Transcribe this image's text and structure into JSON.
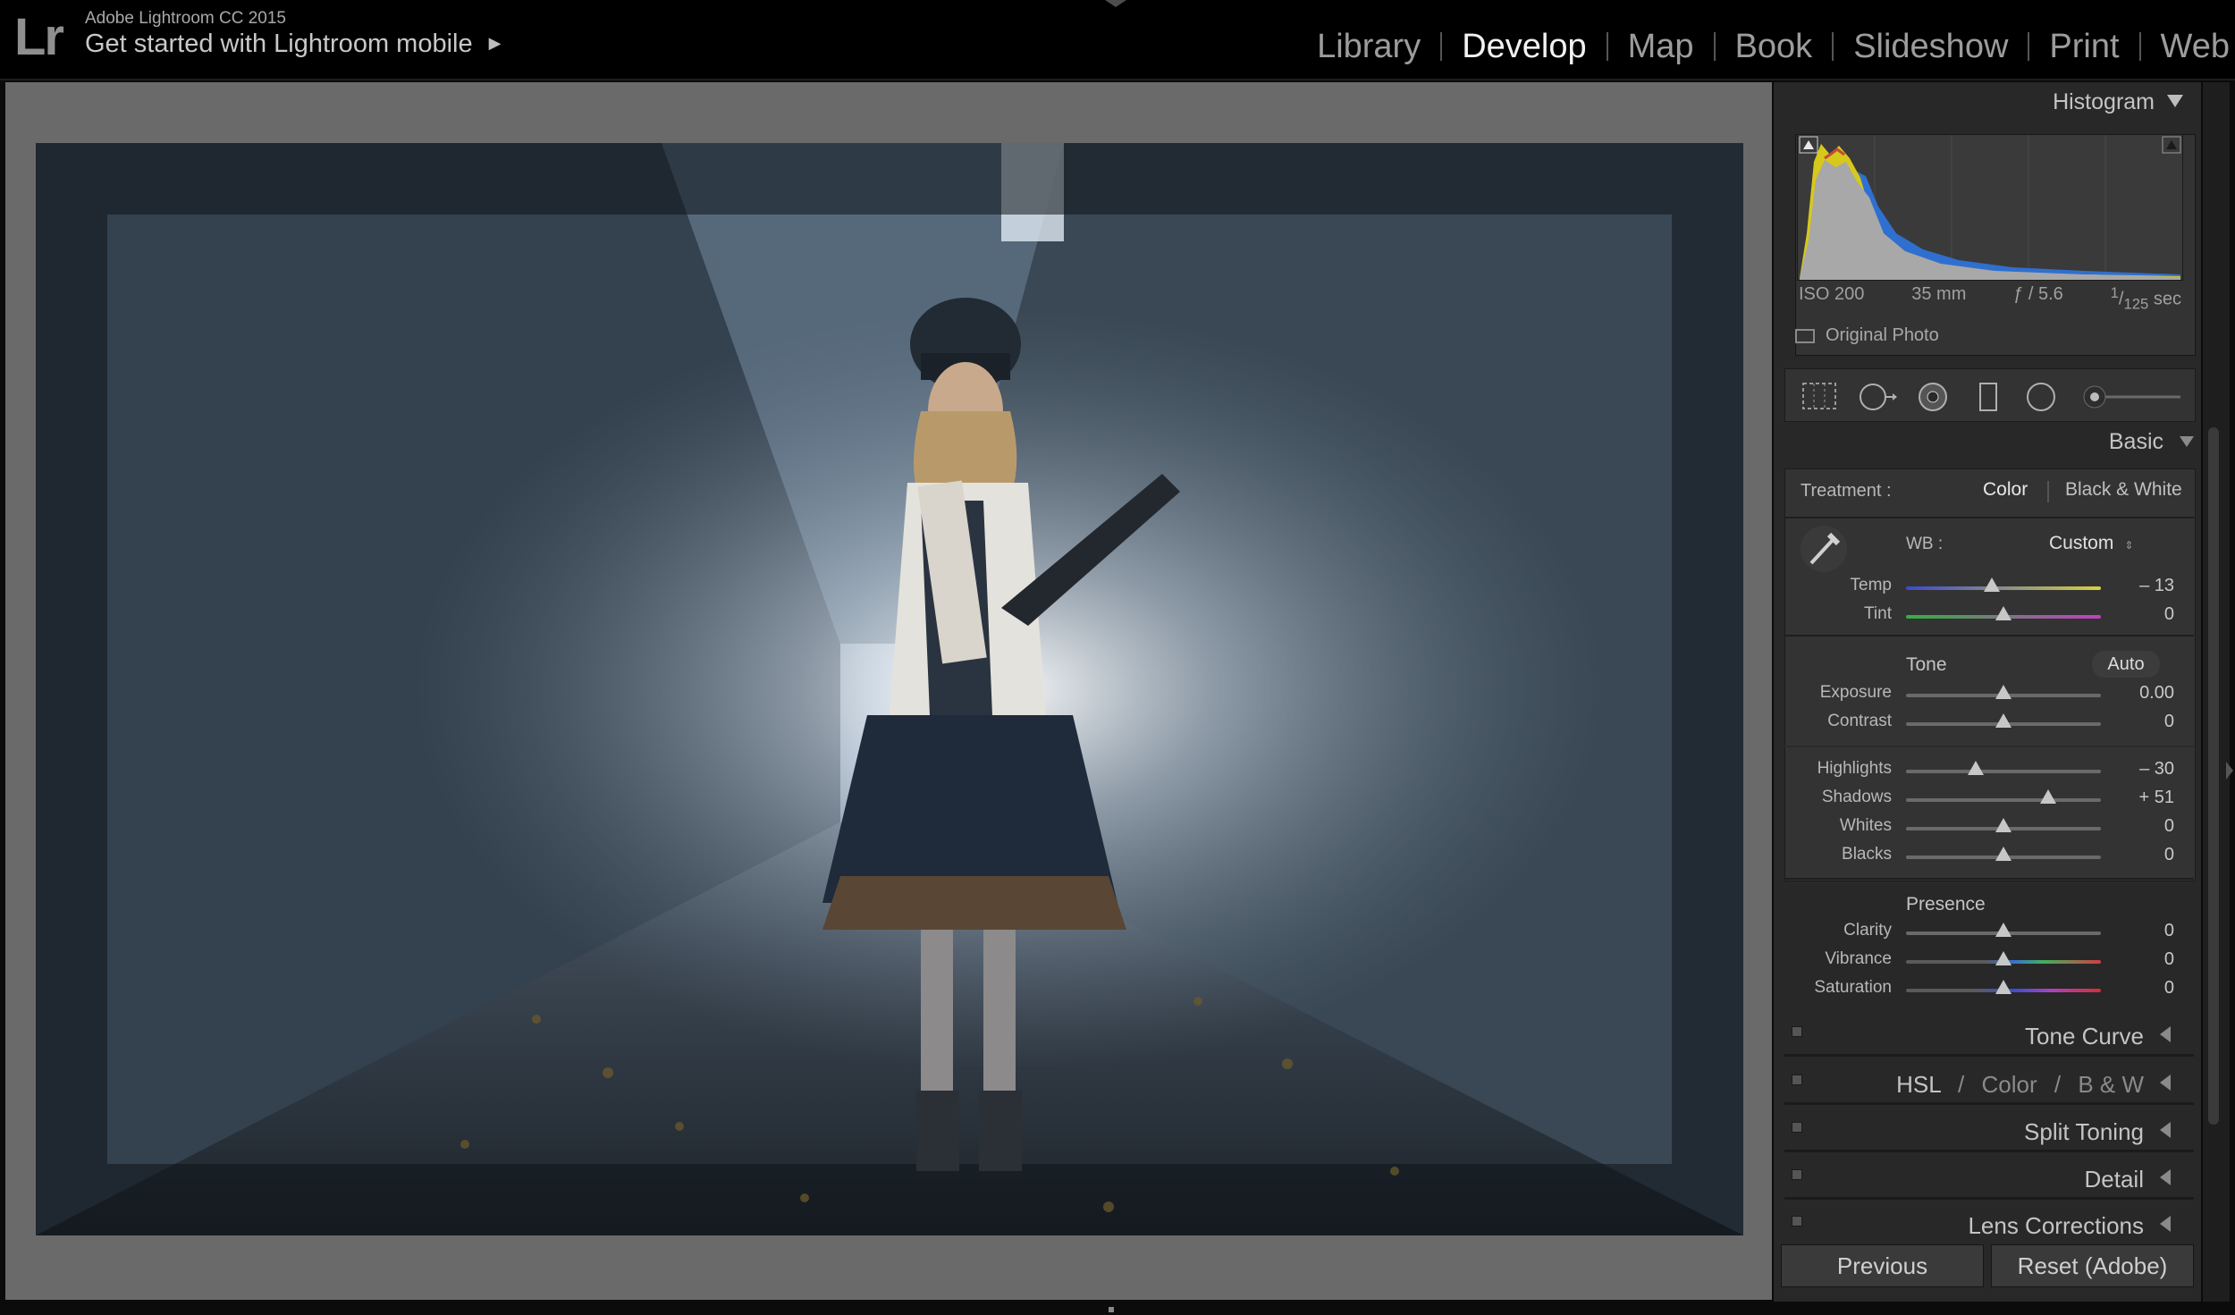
{
  "app": {
    "logo": "Lr",
    "name": "Adobe Lightroom CC 2015",
    "mobile_prompt": "Get started with Lightroom mobile",
    "mobile_arrow": "▶"
  },
  "modules": [
    {
      "label": "Library",
      "active": false
    },
    {
      "label": "Develop",
      "active": true
    },
    {
      "label": "Map",
      "active": false
    },
    {
      "label": "Book",
      "active": false
    },
    {
      "label": "Slideshow",
      "active": false
    },
    {
      "label": "Print",
      "active": false
    },
    {
      "label": "Web",
      "active": false
    }
  ],
  "histogram": {
    "title": "Histogram",
    "iso": "ISO 200",
    "focal": "35 mm",
    "aperture": "ƒ / 5.6",
    "shutter_num": "1",
    "shutter_den": "125",
    "shutter_unit": "sec",
    "original_photo": "Original Photo"
  },
  "basic": {
    "title": "Basic",
    "treatment_label": "Treatment :",
    "treatment_color": "Color",
    "treatment_bw": "Black & White",
    "wb_label": "WB :",
    "wb_value": "Custom",
    "tone_label": "Tone",
    "auto_label": "Auto",
    "presence_label": "Presence",
    "sliders": {
      "temp": {
        "label": "Temp",
        "value": "– 13",
        "pos": 0.44
      },
      "tint": {
        "label": "Tint",
        "value": "0",
        "pos": 0.5
      },
      "exposure": {
        "label": "Exposure",
        "value": "0.00",
        "pos": 0.5
      },
      "contrast": {
        "label": "Contrast",
        "value": "0",
        "pos": 0.5
      },
      "highlights": {
        "label": "Highlights",
        "value": "– 30",
        "pos": 0.36
      },
      "shadows": {
        "label": "Shadows",
        "value": "+ 51",
        "pos": 0.73
      },
      "whites": {
        "label": "Whites",
        "value": "0",
        "pos": 0.5
      },
      "blacks": {
        "label": "Blacks",
        "value": "0",
        "pos": 0.5
      },
      "clarity": {
        "label": "Clarity",
        "value": "0",
        "pos": 0.5
      },
      "vibrance": {
        "label": "Vibrance",
        "value": "0",
        "pos": 0.5
      },
      "saturation": {
        "label": "Saturation",
        "value": "0",
        "pos": 0.5
      }
    }
  },
  "panels": {
    "tone_curve": "Tone Curve",
    "hsl": "HSL",
    "hsl_color": "Color",
    "hsl_bw": "B & W",
    "hsl_sep": "/",
    "split_toning": "Split Toning",
    "detail": "Detail",
    "lens_corrections": "Lens Corrections"
  },
  "buttons": {
    "previous": "Previous",
    "reset": "Reset (Adobe)"
  },
  "colors": {
    "background": "#0b0b0b",
    "panel": "#282828",
    "center_bg": "#6a6a6a",
    "hist_yellow": "#d7c81c",
    "hist_blue": "#2f6fd0"
  }
}
